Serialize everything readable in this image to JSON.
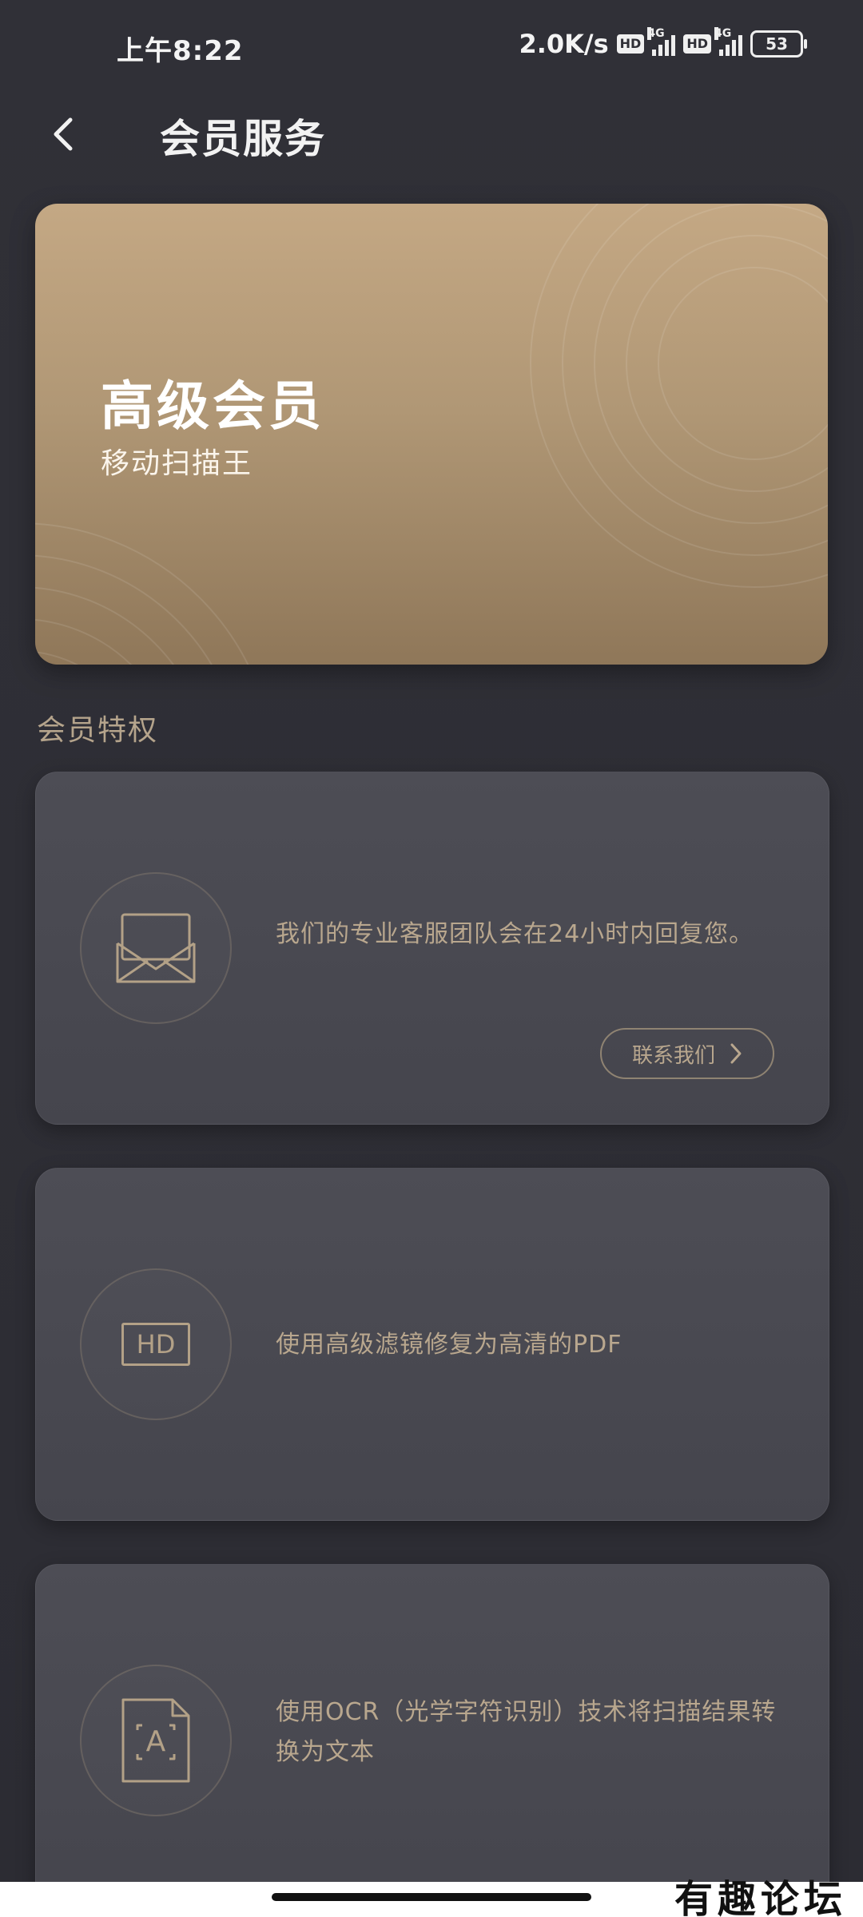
{
  "status_bar": {
    "time": "上午8:22",
    "speed": "2.0K/s",
    "hd_label": "HD",
    "network_label": "4G",
    "battery": "53"
  },
  "header": {
    "title": "会员服务"
  },
  "member_card": {
    "level": "高级会员",
    "app_name": "移动扫描王"
  },
  "section": {
    "title": "会员特权"
  },
  "features": [
    {
      "icon": "envelope-icon",
      "description": "我们的专业客服团队会在24小时内回复您。",
      "button_label": "联系我们"
    },
    {
      "icon": "hd-icon",
      "icon_text": "HD",
      "description": "使用高级滤镜修复为高清的PDF"
    },
    {
      "icon": "ocr-icon",
      "icon_text": "A",
      "description": "使用OCR（光学字符识别）技术将扫描结果转换为文本"
    }
  ],
  "watermark": "有趣论坛",
  "colors": {
    "background": "#2f2f36",
    "card_gold": "#b09775",
    "accent_text": "#b9a78e"
  }
}
